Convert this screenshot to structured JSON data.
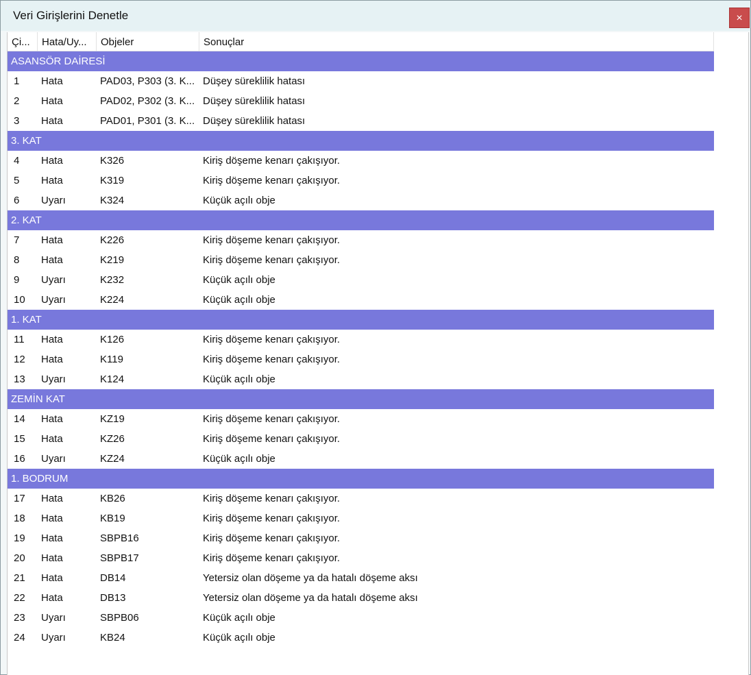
{
  "window": {
    "title": "Veri Girişlerini Denetle",
    "close_glyph": "×"
  },
  "columns": [
    "Çi...",
    "Hata/Uy...",
    "Objeler",
    "Sonuçlar"
  ],
  "groups": [
    {
      "name": "ASANSÖR DAİRESİ",
      "rows": [
        {
          "no": "1",
          "type": "Hata",
          "objects": "PAD03, P303 (3. K...",
          "result": "Düşey süreklilik hatası"
        },
        {
          "no": "2",
          "type": "Hata",
          "objects": "PAD02, P302 (3. K...",
          "result": "Düşey süreklilik hatası"
        },
        {
          "no": "3",
          "type": "Hata",
          "objects": "PAD01, P301 (3. K...",
          "result": "Düşey süreklilik hatası"
        }
      ]
    },
    {
      "name": "3. KAT",
      "rows": [
        {
          "no": "4",
          "type": "Hata",
          "objects": "K326",
          "result": "Kiriş döşeme kenarı çakışıyor."
        },
        {
          "no": "5",
          "type": "Hata",
          "objects": "K319",
          "result": "Kiriş döşeme kenarı çakışıyor."
        },
        {
          "no": "6",
          "type": "Uyarı",
          "objects": "K324",
          "result": "Küçük açılı obje"
        }
      ]
    },
    {
      "name": "2. KAT",
      "rows": [
        {
          "no": "7",
          "type": "Hata",
          "objects": "K226",
          "result": "Kiriş döşeme kenarı çakışıyor."
        },
        {
          "no": "8",
          "type": "Hata",
          "objects": "K219",
          "result": "Kiriş döşeme kenarı çakışıyor."
        },
        {
          "no": "9",
          "type": "Uyarı",
          "objects": "K232",
          "result": "Küçük açılı obje"
        },
        {
          "no": "10",
          "type": "Uyarı",
          "objects": "K224",
          "result": "Küçük açılı obje"
        }
      ]
    },
    {
      "name": "1. KAT",
      "rows": [
        {
          "no": "11",
          "type": "Hata",
          "objects": "K126",
          "result": "Kiriş döşeme kenarı çakışıyor."
        },
        {
          "no": "12",
          "type": "Hata",
          "objects": "K119",
          "result": "Kiriş döşeme kenarı çakışıyor."
        },
        {
          "no": "13",
          "type": "Uyarı",
          "objects": "K124",
          "result": "Küçük açılı obje"
        }
      ]
    },
    {
      "name": "ZEMİN KAT",
      "rows": [
        {
          "no": "14",
          "type": "Hata",
          "objects": "KZ19",
          "result": "Kiriş döşeme kenarı çakışıyor."
        },
        {
          "no": "15",
          "type": "Hata",
          "objects": "KZ26",
          "result": "Kiriş döşeme kenarı çakışıyor."
        },
        {
          "no": "16",
          "type": "Uyarı",
          "objects": "KZ24",
          "result": "Küçük açılı obje"
        }
      ]
    },
    {
      "name": "1. BODRUM",
      "rows": [
        {
          "no": "17",
          "type": "Hata",
          "objects": "KB26",
          "result": "Kiriş döşeme kenarı çakışıyor."
        },
        {
          "no": "18",
          "type": "Hata",
          "objects": "KB19",
          "result": "Kiriş döşeme kenarı çakışıyor."
        },
        {
          "no": "19",
          "type": "Hata",
          "objects": "SBPB16",
          "result": "Kiriş döşeme kenarı çakışıyor."
        },
        {
          "no": "20",
          "type": "Hata",
          "objects": "SBPB17",
          "result": "Kiriş döşeme kenarı çakışıyor."
        },
        {
          "no": "21",
          "type": "Hata",
          "objects": "DB14",
          "result": "Yetersiz olan döşeme ya da hatalı döşeme aksı"
        },
        {
          "no": "22",
          "type": "Hata",
          "objects": "DB13",
          "result": "Yetersiz olan döşeme ya da hatalı döşeme aksı"
        },
        {
          "no": "23",
          "type": "Uyarı",
          "objects": "SBPB06",
          "result": "Küçük açılı obje"
        },
        {
          "no": "24",
          "type": "Uyarı",
          "objects": "KB24",
          "result": "Küçük açılı obje"
        }
      ]
    }
  ],
  "colors": {
    "group_header_bg": "#7878dc",
    "close_button_bg": "#c94c4c",
    "titlebar_bg": "#e6f2f4"
  }
}
